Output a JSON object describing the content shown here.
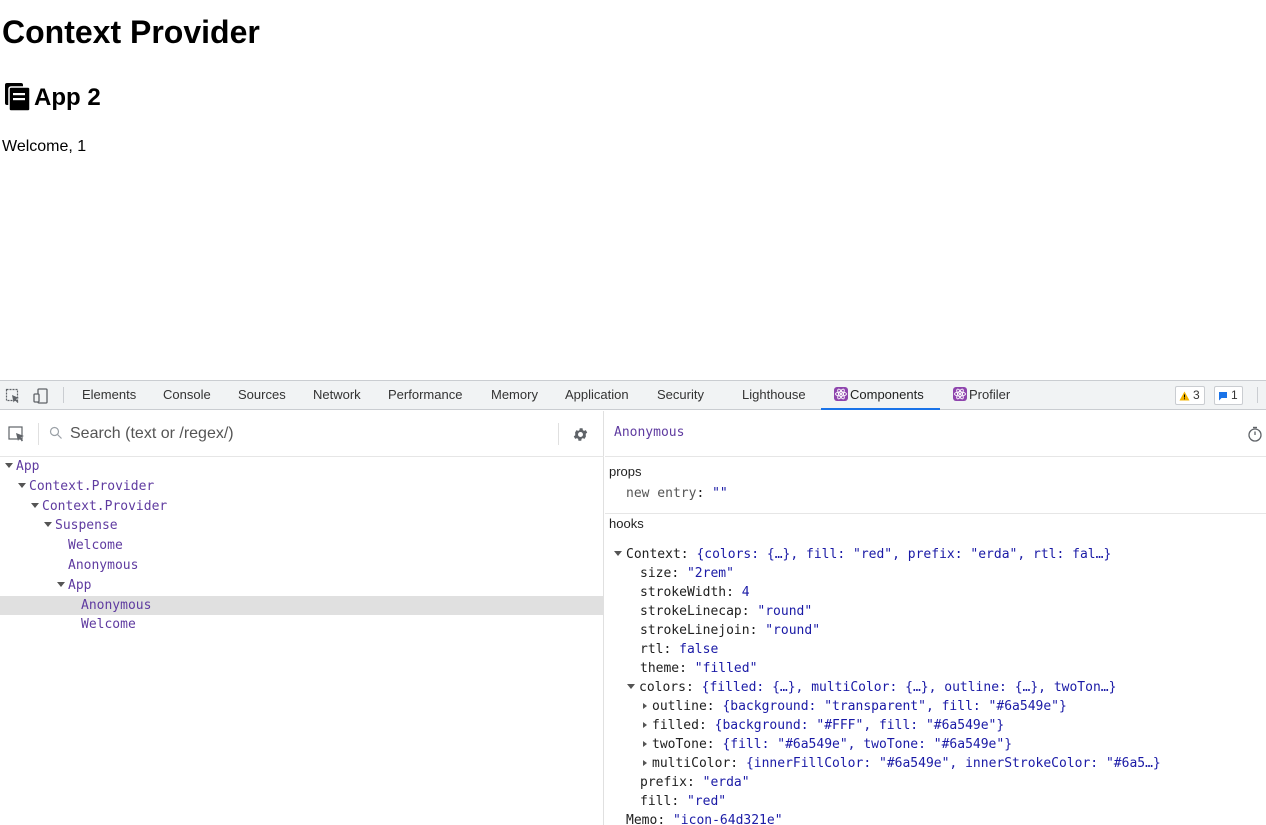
{
  "page": {
    "title": "Context Provider",
    "app_heading": "App 2",
    "welcome": "Welcome, 1"
  },
  "devtools": {
    "tabs": [
      "Elements",
      "Console",
      "Sources",
      "Network",
      "Performance",
      "Memory",
      "Application",
      "Security",
      "Lighthouse",
      "Components",
      "Profiler"
    ],
    "active_tab": "Components",
    "warnings_count": "3",
    "messages_count": "1",
    "search_placeholder": "Search (text or /regex/)",
    "tree": [
      {
        "label": "App",
        "expanded": true
      },
      {
        "label": "Context.Provider",
        "expanded": true
      },
      {
        "label": "Context.Provider",
        "expanded": true
      },
      {
        "label": "Suspense",
        "expanded": true
      },
      {
        "label": "Welcome"
      },
      {
        "label": "Anonymous"
      },
      {
        "label": "App",
        "expanded": true
      },
      {
        "label": "Anonymous",
        "selected": true
      },
      {
        "label": "Welcome"
      }
    ],
    "selected_component": "Anonymous",
    "props_title": "props",
    "props": {
      "key": "new entry",
      "value": "\"\""
    },
    "hooks_title": "hooks",
    "hooks": {
      "context_key": "Context",
      "context_summary": "{colors: {…}, fill: \"red\", prefix: \"erda\", rtl: fal…}",
      "fields": [
        {
          "key": "size",
          "value": "\"2rem\"",
          "kind": "str"
        },
        {
          "key": "strokeWidth",
          "value": "4",
          "kind": "num"
        },
        {
          "key": "strokeLinecap",
          "value": "\"round\"",
          "kind": "str"
        },
        {
          "key": "strokeLinejoin",
          "value": "\"round\"",
          "kind": "str"
        },
        {
          "key": "rtl",
          "value": "false",
          "kind": "num"
        },
        {
          "key": "theme",
          "value": "\"filled\"",
          "kind": "str"
        }
      ],
      "colors_key": "colors",
      "colors_summary": "{filled: {…}, multiColor: {…}, outline: {…}, twoTon…}",
      "colors_children": [
        {
          "key": "outline",
          "value": "{background: \"transparent\", fill: \"#6a549e\"}"
        },
        {
          "key": "filled",
          "value": "{background: \"#FFF\", fill: \"#6a549e\"}"
        },
        {
          "key": "twoTone",
          "value": "{fill: \"#6a549e\", twoTone: \"#6a549e\"}"
        },
        {
          "key": "multiColor",
          "value": "{innerFillColor: \"#6a549e\", innerStrokeColor: \"#6a5…}"
        }
      ],
      "prefix": {
        "key": "prefix",
        "value": "\"erda\""
      },
      "fill": {
        "key": "fill",
        "value": "\"red\""
      },
      "memo": {
        "key": "Memo",
        "value": "\"icon-64d321e\""
      }
    }
  },
  "colors": {
    "component_name": "#5f3ba0",
    "value": "#1a1aa6",
    "active_tab_underline": "#1a73e8",
    "selected_row": "#e0e0e0",
    "warning": "#f4b400",
    "info": "#1a73e8"
  },
  "icons": [
    "app-copy-icon",
    "inspect-element-icon",
    "device-toggle-icon",
    "react-icon",
    "warning-icon",
    "message-icon",
    "select-component-icon",
    "search-icon",
    "gear-icon",
    "stopwatch-icon"
  ]
}
